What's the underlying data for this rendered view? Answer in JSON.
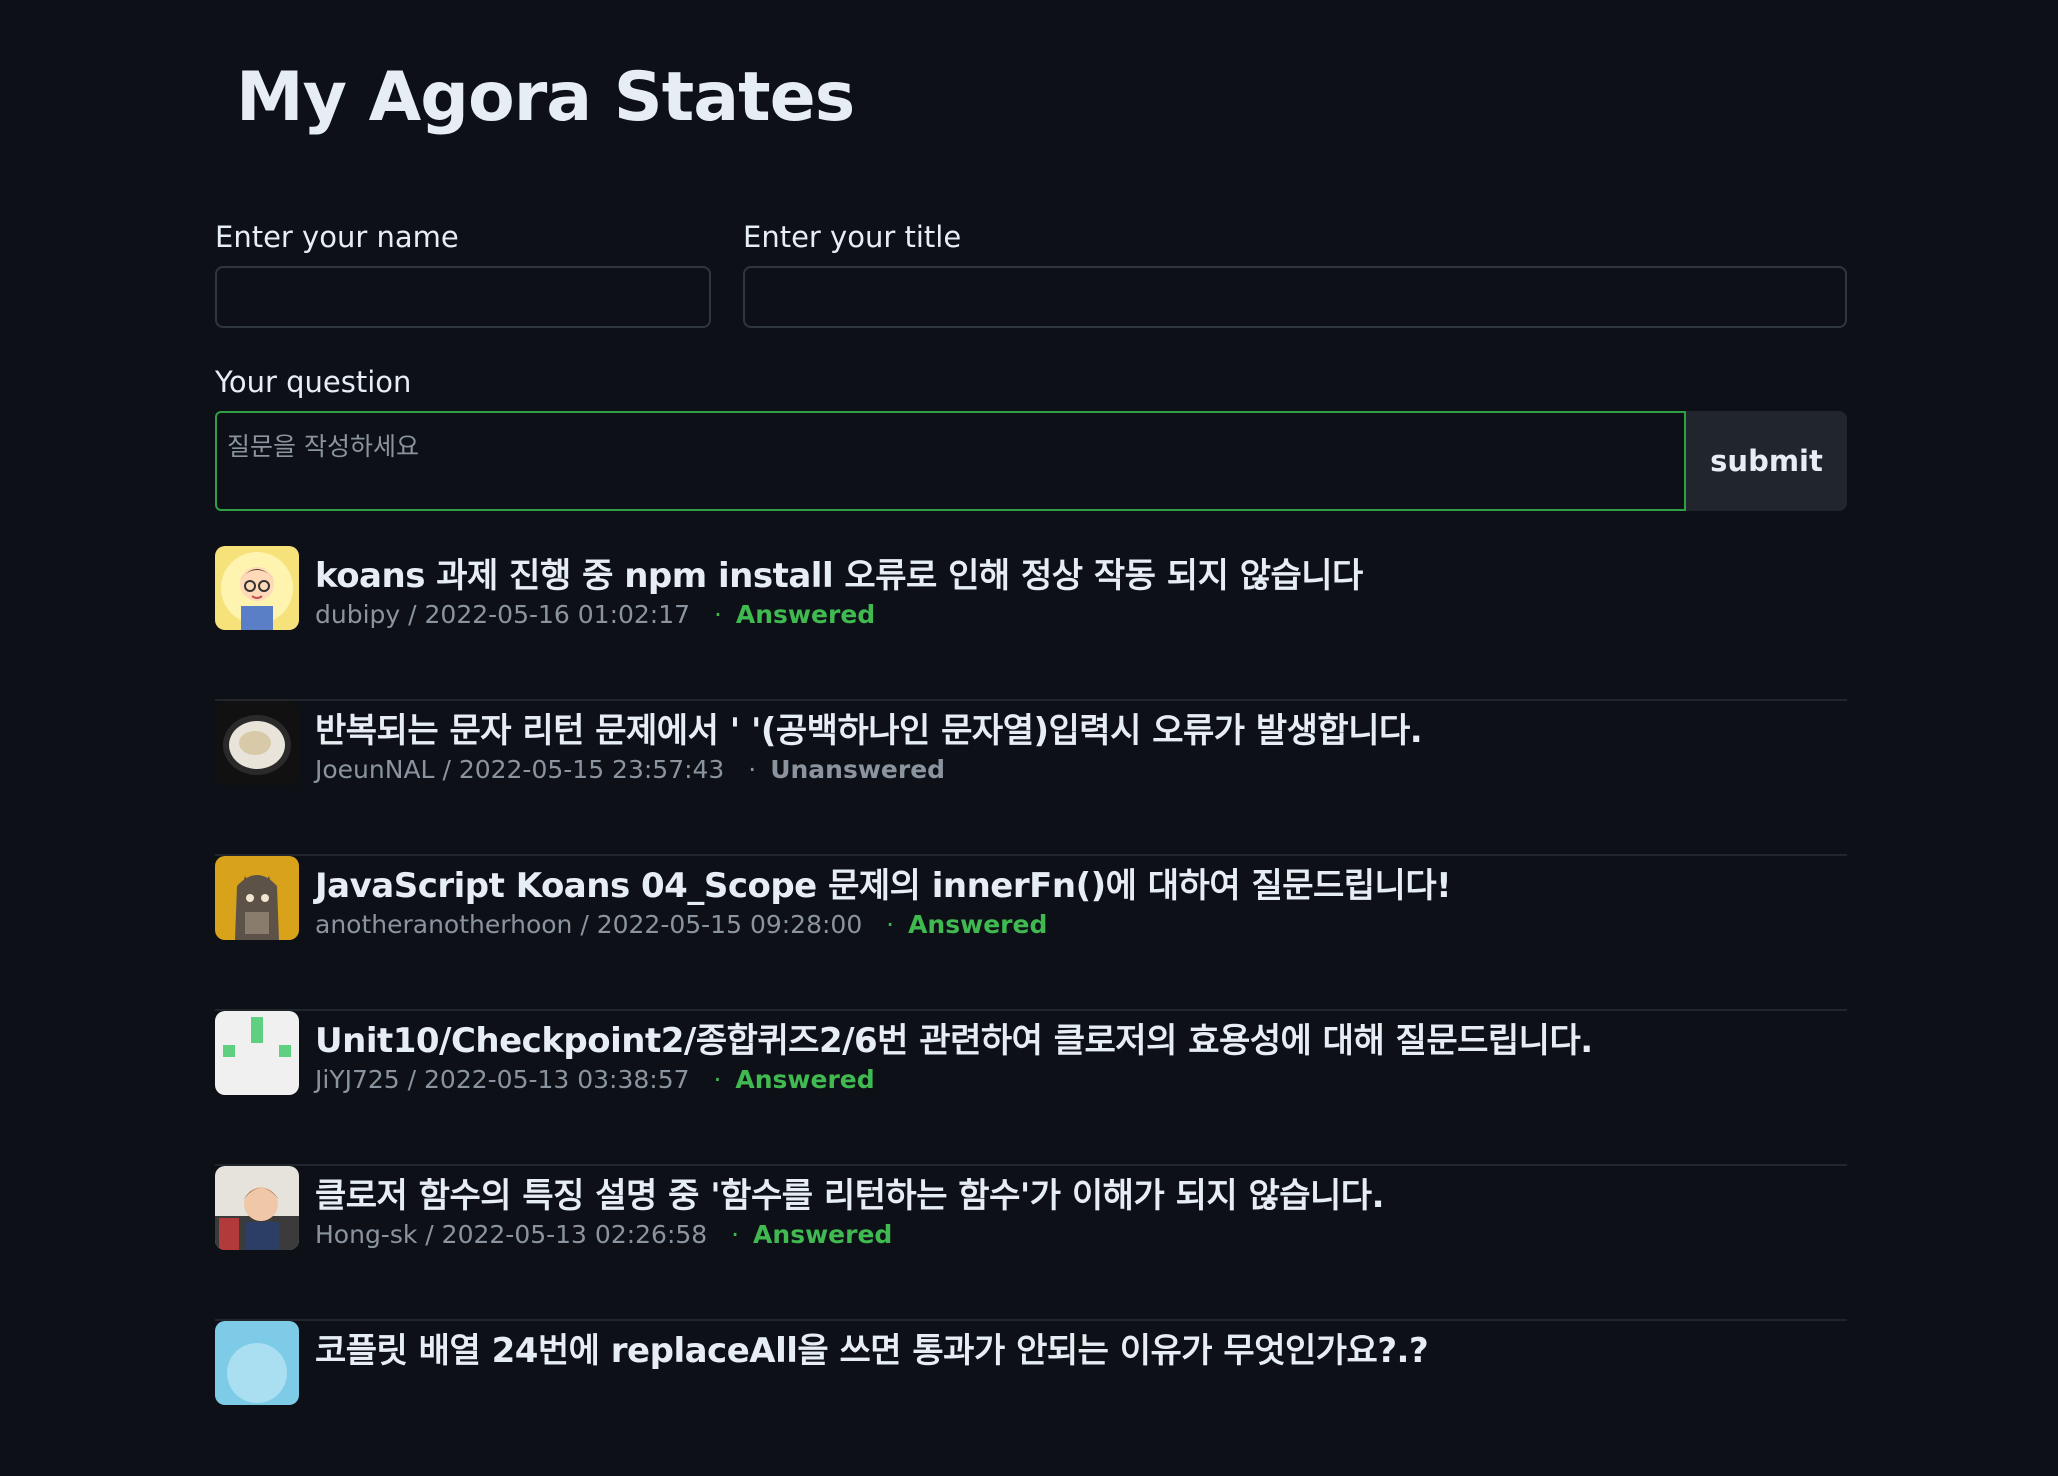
{
  "page": {
    "title": "My Agora States"
  },
  "form": {
    "name_label": "Enter your name",
    "name_value": "",
    "title_label": "Enter your title",
    "title_value": "",
    "question_label": "Your question",
    "question_placeholder": "질문을 작성하세요",
    "submit_label": "submit"
  },
  "colors": {
    "background": "#0d1117",
    "answered": "#3fb950",
    "unanswered": "#8b949e",
    "focus_border": "#2ea043"
  },
  "separator": "·",
  "discussions": [
    {
      "title": "koans 과제 진행 중 npm install 오류로 인해 정상 작동 되지 않습니다",
      "author": "dubipy",
      "date": "2022-05-16 01:02:17",
      "status": "Answered"
    },
    {
      "title": "반복되는 문자 리턴 문제에서 ' '(공백하나인 문자열)입력시 오류가 발생합니다.",
      "author": "JoeunNAL",
      "date": "2022-05-15 23:57:43",
      "status": "Unanswered"
    },
    {
      "title": "JavaScript Koans 04_Scope 문제의 innerFn()에 대하여 질문드립니다!",
      "author": "anotheranotherhoon",
      "date": "2022-05-15 09:28:00",
      "status": "Answered"
    },
    {
      "title": "Unit10/Checkpoint2/종합퀴즈2/6번 관련하여 클로저의 효용성에 대해 질문드립니다.",
      "author": "JiYJ725",
      "date": "2022-05-13 03:38:57",
      "status": "Answered"
    },
    {
      "title": "클로저 함수의 특징 설명 중 '함수를 리턴하는 함수'가 이해가 되지 않습니다.",
      "author": "Hong-sk",
      "date": "2022-05-13 02:26:58",
      "status": "Answered"
    },
    {
      "title": "코플릿 배열 24번에 replaceAll을 쓰면 통과가 안되는 이유가 무엇인가요?.?",
      "author": "",
      "date": "",
      "status": ""
    }
  ]
}
